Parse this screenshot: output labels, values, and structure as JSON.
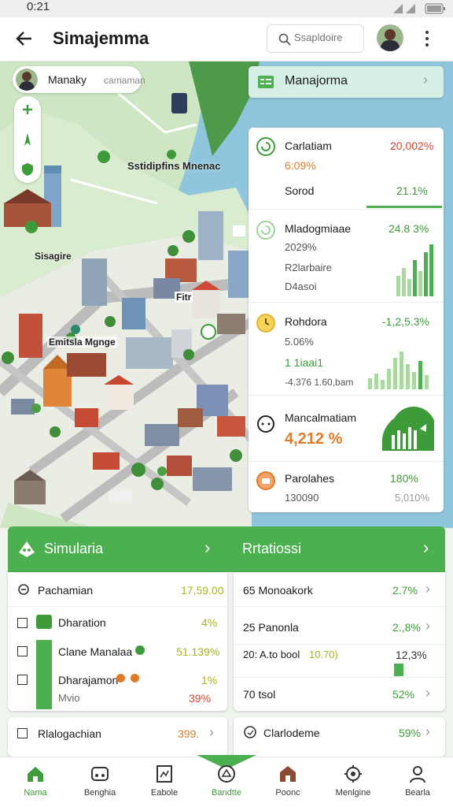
{
  "status": {
    "time": "0:21"
  },
  "header": {
    "title": "Simajemma",
    "search_placeholder": "Ssapldoire"
  },
  "map": {
    "user_chip": "Manaky",
    "user_chip_sub": "camaman",
    "labels": [
      "Sstidipfins Mnenac",
      "Sisagire",
      "Fitr",
      "Emitsla Mgnge"
    ],
    "top_panel": "Manajorma"
  },
  "stats": [
    {
      "title": "Carlatiam",
      "value": "20,002%",
      "sub": "6:09%",
      "note": "Sorod",
      "note_value": "21.1%"
    },
    {
      "title": "Mladogmiaae",
      "value": "24.8 3%",
      "sub": "2029%",
      "sub2": "R2larbaire",
      "sub3": "D4asoi"
    },
    {
      "title": "Rohdora",
      "value": "-1,2,5.3%",
      "sub": "5.06%",
      "sub2": "1 1iaai1",
      "sub3": "-4.376 1.60,bam"
    },
    {
      "title": "Mancalmatiam",
      "value": "4,212 %"
    },
    {
      "title": "Parolahes",
      "value": "180%",
      "sub": "130090",
      "sub_value": "5,010%"
    }
  ],
  "simulation": {
    "title": "Simularia",
    "rows": [
      {
        "label": "Pachamian",
        "value": "17,59.00"
      },
      {
        "label": "Dharation",
        "value": "4%"
      },
      {
        "label": "Clane Manalaa",
        "value": "51.139%"
      },
      {
        "label": "Dharajamon",
        "value": "1%",
        "sub": "Mvio",
        "sub_value": "39%"
      }
    ],
    "footer_label": "Rlalogachian",
    "footer_value": "399."
  },
  "statistics": {
    "title": "Rrtatiossi",
    "rows": [
      {
        "label": "65 Monoakork",
        "value": "2.7%"
      },
      {
        "label": "25 Panonla",
        "value": "2.,8%"
      },
      {
        "label": "20: A.to bool",
        "mid": "10.70)",
        "value": "12,3%"
      },
      {
        "label": "70 tsol",
        "value": "52%"
      }
    ],
    "footer_label": "Clarlodeme",
    "footer_value": "59%"
  },
  "nav": [
    {
      "label": "Nama",
      "icon": "home-icon"
    },
    {
      "label": "Benghia",
      "icon": "bus-icon"
    },
    {
      "label": "Eabole",
      "icon": "document-icon"
    },
    {
      "label": "Bandtte",
      "icon": "cube-icon"
    },
    {
      "label": "Poonc",
      "icon": "building-icon"
    },
    {
      "label": "Menlgine",
      "icon": "gear-icon"
    },
    {
      "label": "Bearla",
      "icon": "user-icon"
    }
  ],
  "colors": {
    "accent": "#4caf50",
    "accent_dark": "#3d9b3a",
    "water": "#8fc5dd",
    "land": "#cfe6c4"
  }
}
